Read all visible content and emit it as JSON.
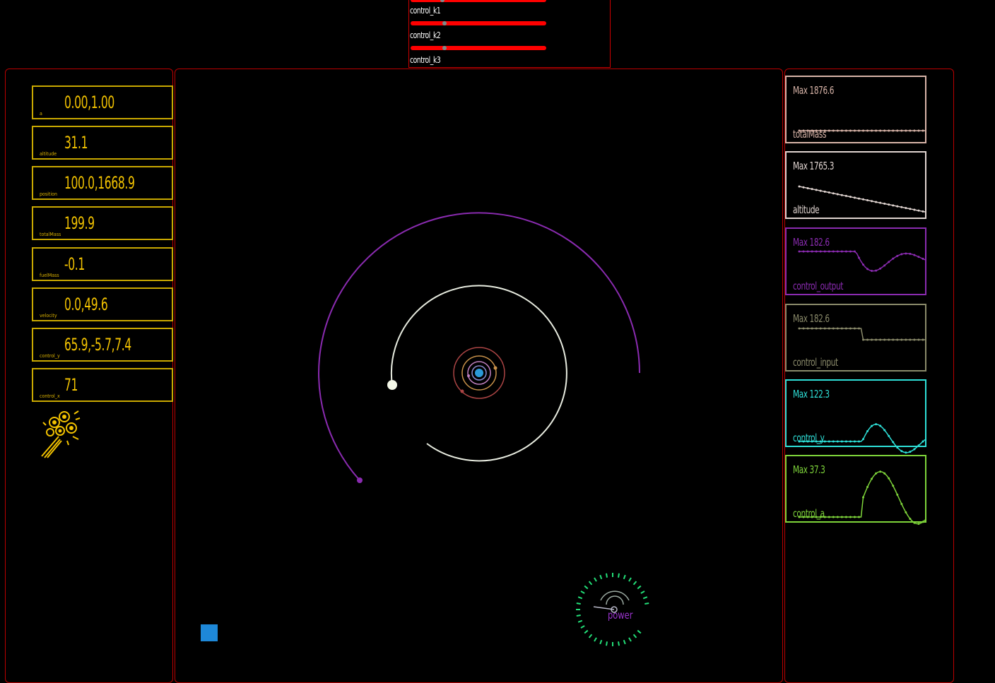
{
  "sliders": [
    {
      "label": "control_k1",
      "value": 0.25
    },
    {
      "label": "control_k2",
      "value": 0.25
    },
    {
      "label": "control_k3",
      "value": 0.2
    }
  ],
  "readouts": [
    {
      "value": "0.00,1.00",
      "label": "a"
    },
    {
      "value": "31.1",
      "label": "altitude"
    },
    {
      "value": "100.0,1668.9",
      "label": "position"
    },
    {
      "value": "199.9",
      "label": "totalMass"
    },
    {
      "value": "-0.1",
      "label": "fuelMass"
    },
    {
      "value": "0.0,49.6",
      "label": "velocity"
    },
    {
      "value": "65.9,-5.7,7.4",
      "label": "control_y"
    },
    {
      "value": "71",
      "label": "control_x"
    }
  ],
  "graphs": [
    {
      "max": "Max 1876.6",
      "name": "totalMass",
      "color": "#d8b4a8"
    },
    {
      "max": "Max 1765.3",
      "name": "altitude",
      "color": "#e0d4d0"
    },
    {
      "max": "Max 182.6",
      "name": "control_output",
      "color": "#8a2bb0"
    },
    {
      "max": "Max 182.6",
      "name": "control_input",
      "color": "#8a8a6a"
    },
    {
      "max": "Max 122.3",
      "name": "control_y",
      "color": "#2ee0d8"
    },
    {
      "max": "Max 37.3",
      "name": "control_a",
      "color": "#7ed43a"
    }
  ],
  "gauge": {
    "label": "power",
    "color": "#22dd77"
  },
  "colors": {
    "accent_yellow": "#f2c200",
    "panel_border": "#b00000",
    "orbit_purple": "#8a2bb0",
    "orbit_white": "#e8ece0"
  }
}
